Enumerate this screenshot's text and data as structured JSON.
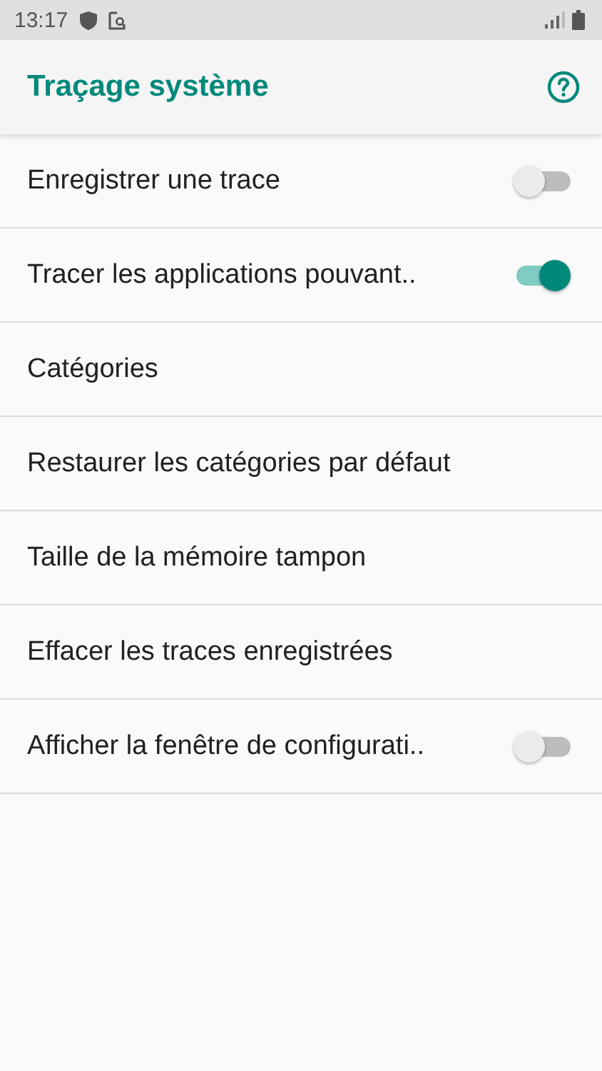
{
  "status_bar": {
    "time": "13:17"
  },
  "app_bar": {
    "title": "Traçage système"
  },
  "items": [
    {
      "kind": "switch",
      "label": "Enregistrer une trace",
      "on": false
    },
    {
      "kind": "switch",
      "label": "Tracer les applications pouvant..",
      "on": true
    },
    {
      "kind": "plain",
      "label": "Catégories"
    },
    {
      "kind": "plain",
      "label": "Restaurer les catégories par défaut"
    },
    {
      "kind": "plain",
      "label": "Taille de la mémoire tampon"
    },
    {
      "kind": "plain",
      "label": "Effacer les traces enregistrées"
    },
    {
      "kind": "switch",
      "label": "Afficher la fenêtre de configurati..",
      "on": false
    }
  ]
}
